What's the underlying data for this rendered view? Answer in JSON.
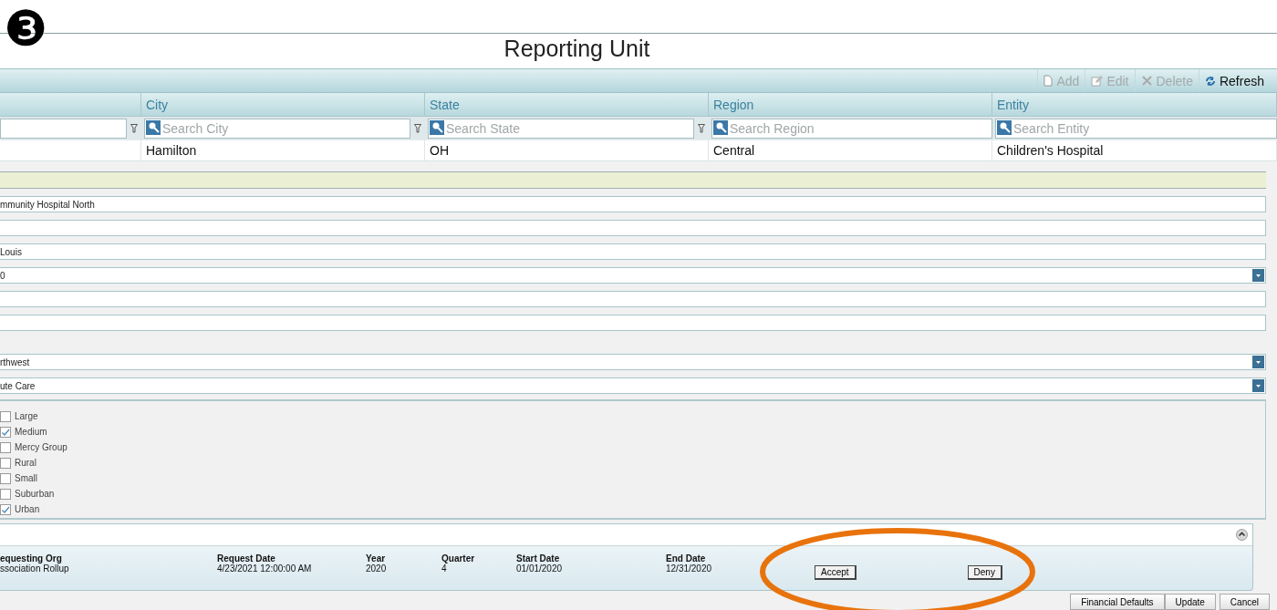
{
  "badge": "❸",
  "title": "Reporting Unit",
  "toolbar": [
    {
      "label": "Add",
      "disabled": true
    },
    {
      "label": "Edit",
      "disabled": true
    },
    {
      "label": "Delete",
      "disabled": true
    },
    {
      "label": "Refresh",
      "disabled": false
    }
  ],
  "grid": {
    "columns": [
      {
        "filter_icon": true
      },
      {
        "label": "City",
        "placeholder": "Search City",
        "filter_icon": true
      },
      {
        "label": "State",
        "placeholder": "Search State",
        "filter_icon": true
      },
      {
        "label": "Region",
        "placeholder": "Search Region",
        "filter_icon": false
      },
      {
        "label": "Entity",
        "placeholder": "Search Entity",
        "filter_icon": false
      }
    ],
    "rows": [
      [
        "",
        "Hamilton",
        "OH",
        "Central",
        "Children's Hospital"
      ]
    ]
  },
  "form": {
    "groups": [
      [
        {
          "kind": "text",
          "value": "mmunity Hospital North"
        },
        {
          "kind": "text"
        },
        {
          "kind": "text",
          "value": "Louis"
        },
        {
          "kind": "select",
          "value": "0"
        },
        {
          "kind": "text"
        },
        {
          "kind": "text"
        }
      ],
      [
        {
          "kind": "select",
          "value": "rthwest"
        },
        {
          "kind": "select",
          "value": "ute Care"
        }
      ]
    ],
    "checkboxes": [
      {
        "label": "Large",
        "checked": false
      },
      {
        "label": "Medium",
        "checked": true
      },
      {
        "label": "Mercy Group",
        "checked": false
      },
      {
        "label": "Rural",
        "checked": false
      },
      {
        "label": "Small",
        "checked": false
      },
      {
        "label": "Suburban",
        "checked": false
      },
      {
        "label": "Urban",
        "checked": true
      }
    ]
  },
  "request": {
    "columns": [
      {
        "label": "equesting Org",
        "value": "ssociation Rollup"
      },
      {
        "label": "Request Date",
        "value": "4/23/2021 12:00:00 AM"
      },
      {
        "label": "Year",
        "value": "2020"
      },
      {
        "label": "Quarter",
        "value": "4"
      },
      {
        "label": "Start Date",
        "value": "01/01/2020"
      },
      {
        "label": "End Date",
        "value": "12/31/2020"
      }
    ],
    "actions": [
      "Accept",
      "Deny"
    ]
  },
  "buttons": [
    "Financial Defaults",
    "Update",
    "Cancel"
  ]
}
